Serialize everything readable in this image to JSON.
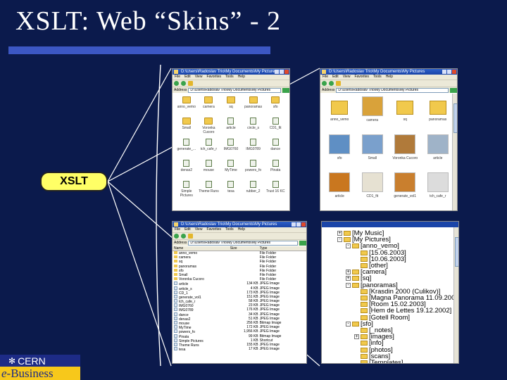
{
  "slide": {
    "title": "XSLT: Web “Skins” - 2",
    "badge": "XSLT",
    "logo": {
      "top": "CERN",
      "bottom_e": "e",
      "bottom_rest": "-Business"
    }
  },
  "colors": {
    "background": "#0b1a4c",
    "title_bar": "#3c57c3",
    "badge": "#ffff66",
    "logo_blue": "#1d2b86",
    "logo_yellow": "#f7c81b"
  },
  "windows": {
    "icons_view": {
      "title": "D:\\Users\\Radoslav Trio\\My Documents\\My Pictures",
      "menu": [
        "File",
        "Edit",
        "View",
        "Favorites",
        "Tools",
        "Help"
      ],
      "address_label": "Address",
      "address": "D:\\Users\\Radoslav Trio\\My Documents\\My Pictures",
      "items": [
        {
          "label": "anno_vemo",
          "kind": "folder"
        },
        {
          "label": "camera",
          "kind": "folder"
        },
        {
          "label": "sq",
          "kind": "folder"
        },
        {
          "label": "panoramas",
          "kind": "folder"
        },
        {
          "label": "sfo",
          "kind": "folder"
        },
        {
          "label": "Small",
          "kind": "folder"
        },
        {
          "label": "Voronka Cucoro",
          "kind": "folder"
        },
        {
          "label": "article",
          "kind": "doc"
        },
        {
          "label": "circle_s",
          "kind": "doc"
        },
        {
          "label": "CD1_fit",
          "kind": "doc"
        },
        {
          "label": "generate_...",
          "kind": "doc"
        },
        {
          "label": "tch_cafe_r",
          "kind": "doc"
        },
        {
          "label": "IMG0760",
          "kind": "doc"
        },
        {
          "label": "IMG0789",
          "kind": "doc"
        },
        {
          "label": "dance",
          "kind": "doc"
        },
        {
          "label": "denas2",
          "kind": "doc"
        },
        {
          "label": "mouse",
          "kind": "doc"
        },
        {
          "label": "MyTime",
          "kind": "doc"
        },
        {
          "label": "powers_fo",
          "kind": "doc"
        },
        {
          "label": "Pinata",
          "kind": "doc"
        },
        {
          "label": "Simple Pictures",
          "kind": "doc"
        },
        {
          "label": "Theme Runs",
          "kind": "doc"
        },
        {
          "label": "tesa",
          "kind": "doc"
        },
        {
          "label": "rubber_2",
          "kind": "doc"
        },
        {
          "label": "Trust 16 KC",
          "kind": "doc"
        }
      ]
    },
    "thumbs_view": {
      "title": "D:\\Users\\Radoslav Trio\\My Documents\\My Pictures",
      "menu": [
        "File",
        "Edit",
        "View",
        "Favorites",
        "Tools",
        "Help"
      ],
      "address_label": "Address",
      "address": "D:\\Users\\Radoslav Trio\\My Documents\\My Pictures",
      "items": [
        {
          "label": "anno_vemo",
          "kind": "folder"
        },
        {
          "label": "camera",
          "kind": "photo",
          "color": "#d9a23a"
        },
        {
          "label": "sq",
          "kind": "folder"
        },
        {
          "label": "panoramas",
          "kind": "folder"
        },
        {
          "label": "sfo",
          "kind": "photo",
          "color": "#5f8fc4"
        },
        {
          "label": "Small",
          "kind": "photo",
          "color": "#7aa0cc"
        },
        {
          "label": "Voronka Cucoro",
          "kind": "photo",
          "color": "#b07a3a"
        },
        {
          "label": "article",
          "kind": "photo",
          "color": "#9fb3c8"
        },
        {
          "label": "article",
          "kind": "photo",
          "color": "#c9771f"
        },
        {
          "label": "CD1_fit",
          "kind": "photo",
          "color": "#e6e1d2"
        },
        {
          "label": "generate_vol1",
          "kind": "photo",
          "color": "#c97f2e"
        },
        {
          "label": "tch_cafe_r",
          "kind": "photo",
          "color": "#dcdcdc"
        }
      ]
    },
    "details_view": {
      "title": "D:\\Users\\Radoslav Trio\\My Documents\\My Pictures",
      "menu": [
        "File",
        "Edit",
        "View",
        "Favorites",
        "Tools",
        "Help"
      ],
      "address_label": "Address",
      "address": "D:\\Users\\Radoslav Trio\\My Documents\\My Pictures",
      "columns": [
        "Name",
        "Size",
        "Type"
      ],
      "rows": [
        [
          "anno_vemo",
          "",
          "File Folder"
        ],
        [
          "camera",
          "",
          "File Folder"
        ],
        [
          "sq",
          "",
          "File Folder"
        ],
        [
          "panoramas",
          "",
          "File Folder"
        ],
        [
          "sfo",
          "",
          "File Folder"
        ],
        [
          "Small",
          "",
          "File Folder"
        ],
        [
          "Voronka Cucoro",
          "",
          "File Folder"
        ],
        [
          "article",
          "134 KB",
          "JPEG Image"
        ],
        [
          "article_s",
          "4 KB",
          "JPEG Image"
        ],
        [
          "CD_1",
          "173 KB",
          "JPEG Image"
        ],
        [
          "generate_vol1",
          "151 KB",
          "JPEG Image"
        ],
        [
          "tch_cafe_r",
          "58 KB",
          "JPEG Image"
        ],
        [
          "IMG0760",
          "23 KB",
          "JPEG Image"
        ],
        [
          "IMG0789",
          "176 KB",
          "JPEG Image"
        ],
        [
          "dance",
          "34 KB",
          "JPEG Image"
        ],
        [
          "denas2",
          "51 KB",
          "JPEG Image"
        ],
        [
          "mouse",
          "256 KB",
          "Bitmap Image"
        ],
        [
          "MyTime",
          "172 KB",
          "JPEG Image"
        ],
        [
          "powers_fo",
          "1,956 KB",
          "JPEG Image"
        ],
        [
          "Pinata",
          "99 KB",
          "Bitmap Image"
        ],
        [
          "Simple Pictures",
          "1 KB",
          "Shortcut"
        ],
        [
          "Theme Runs",
          "155 KB",
          "JPEG Image"
        ],
        [
          "tesa",
          "17 KB",
          "JPEG Image"
        ]
      ]
    },
    "tree_view": {
      "items": [
        {
          "text": "[My Music]",
          "level": 0,
          "box": "+"
        },
        {
          "text": "[My Pictures]",
          "level": 0,
          "box": "-"
        },
        {
          "text": "[anno_vemo]",
          "level": 1,
          "box": "-"
        },
        {
          "text": "[15.06.2003]",
          "level": 2,
          "box": ""
        },
        {
          "text": "[10.06.2003]",
          "level": 2,
          "box": ""
        },
        {
          "text": "[other]",
          "level": 2,
          "box": ""
        },
        {
          "text": "[camera]",
          "level": 1,
          "box": "+"
        },
        {
          "text": "[sq]",
          "level": 1,
          "box": "+"
        },
        {
          "text": "[panoramas]",
          "level": 1,
          "box": "-"
        },
        {
          "text": "[Krasdin 2000 (Culikov)]",
          "level": 2,
          "box": ""
        },
        {
          "text": "[Magna Panorama 11.09.2001]",
          "level": 2,
          "box": ""
        },
        {
          "text": "[Room 15.02.2003]",
          "level": 2,
          "box": ""
        },
        {
          "text": "[Hem de Lettes 19.12.2002]",
          "level": 2,
          "box": ""
        },
        {
          "text": "[Gotell Room]",
          "level": 2,
          "box": ""
        },
        {
          "text": "[sfo]",
          "level": 1,
          "box": "-"
        },
        {
          "text": "[_notes]",
          "level": 2,
          "box": ""
        },
        {
          "text": "[images]",
          "level": 2,
          "box": "+"
        },
        {
          "text": "[info]",
          "level": 2,
          "box": ""
        },
        {
          "text": "[photos]",
          "level": 2,
          "box": ""
        },
        {
          "text": "[scans]",
          "level": 2,
          "box": ""
        },
        {
          "text": "[Templates]",
          "level": 2,
          "box": ""
        },
        {
          "text": "[Small]",
          "level": 1,
          "box": ""
        },
        {
          "text": "[Voronka Cucoro]",
          "level": 1,
          "box": ""
        }
      ]
    }
  }
}
